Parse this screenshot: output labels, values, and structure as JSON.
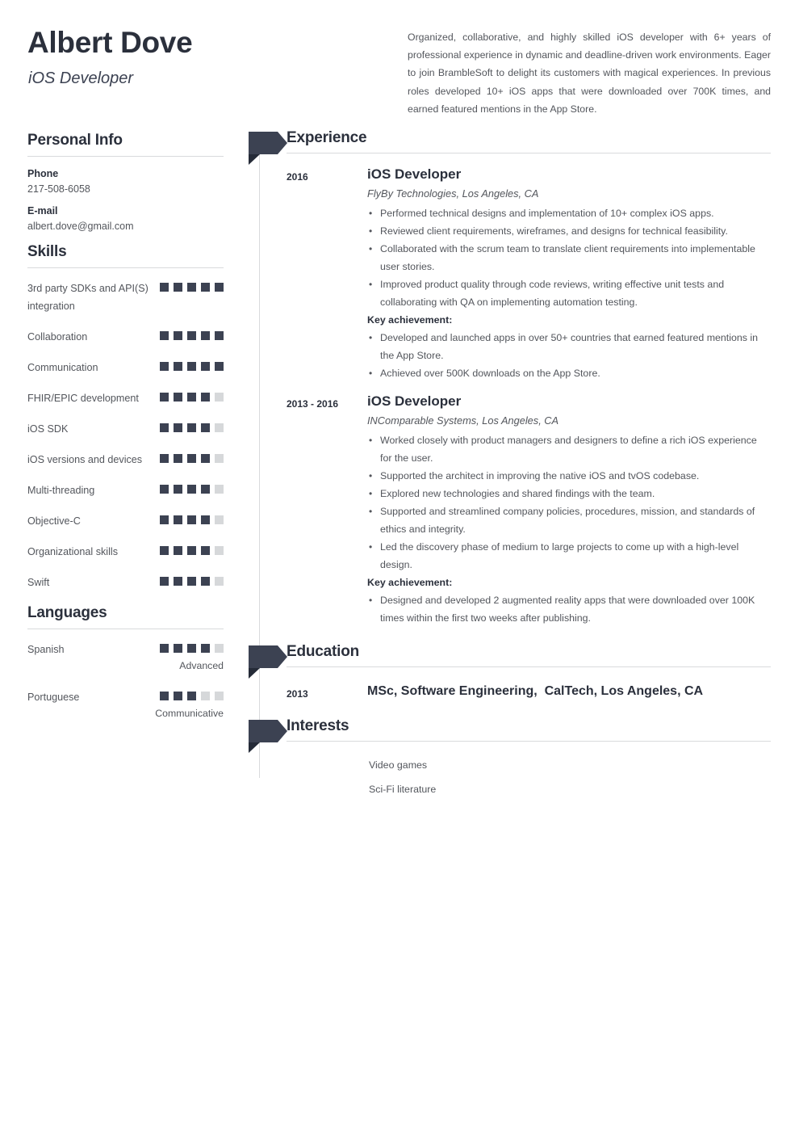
{
  "header": {
    "name": "Albert Dove",
    "job_title": "iOS Developer",
    "summary": "Organized, collaborative, and highly skilled iOS developer with 6+ years of professional experience in dynamic and deadline-driven work environments. Eager to join BrambleSoft to delight its customers with magical experiences. In previous roles developed 10+ iOS apps that were downloaded over 700K times, and earned featured mentions in the App Store."
  },
  "sidebar": {
    "personal_info": {
      "heading": "Personal Info",
      "fields": [
        {
          "label": "Phone",
          "value": "217-508-6058"
        },
        {
          "label": "E-mail",
          "value": "albert.dove@gmail.com"
        }
      ]
    },
    "skills": {
      "heading": "Skills",
      "max": 5,
      "items": [
        {
          "label": "3rd party SDKs and API(S) integration",
          "level": 5
        },
        {
          "label": "Collaboration",
          "level": 5
        },
        {
          "label": "Communication",
          "level": 5
        },
        {
          "label": "FHIR/EPIC development",
          "level": 4
        },
        {
          "label": "iOS SDK",
          "level": 4
        },
        {
          "label": "iOS versions and devices",
          "level": 4
        },
        {
          "label": "Multi-threading",
          "level": 4
        },
        {
          "label": "Objective-C",
          "level": 4
        },
        {
          "label": "Organizational skills",
          "level": 4
        },
        {
          "label": "Swift",
          "level": 4
        }
      ]
    },
    "languages": {
      "heading": "Languages",
      "max": 5,
      "items": [
        {
          "label": "Spanish",
          "level": 4,
          "note": "Advanced"
        },
        {
          "label": "Portuguese",
          "level": 3,
          "note": "Communicative"
        }
      ]
    }
  },
  "main": {
    "experience": {
      "heading": "Experience",
      "entries": [
        {
          "date": "2016",
          "role": "iOS Developer",
          "org": "FlyBy Technologies, Los Angeles, CA",
          "bullets": [
            "Performed technical designs and implementation of 10+ complex iOS apps.",
            "Reviewed client requirements, wireframes, and designs for technical feasibility.",
            "Collaborated with the scrum team to translate client requirements into implementable user stories.",
            "Improved product quality through code reviews, writing effective unit tests and collaborating with QA on implementing automation testing."
          ],
          "key_achievement_label": "Key achievement:",
          "achievements": [
            "Developed and launched apps in over 50+ countries that earned featured mentions in the App Store.",
            "Achieved over 500K downloads on the App Store."
          ]
        },
        {
          "date": "2013 - 2016",
          "role": "iOS Developer",
          "org": "INComparable Systems, Los Angeles, CA",
          "bullets": [
            "Worked closely with product managers and designers to define a rich iOS experience for the user.",
            "Supported the architect in improving the native iOS and tvOS codebase.",
            "Explored new technologies and shared findings with the team.",
            "Supported and streamlined company policies, procedures, mission, and standards of ethics and integrity.",
            "Led the discovery phase of medium to large projects to come up with a high-level design."
          ],
          "key_achievement_label": "Key achievement:",
          "achievements": [
            "Designed and developed 2 augmented reality apps that were downloaded over 100K times within the first two weeks after publishing."
          ]
        }
      ]
    },
    "education": {
      "heading": "Education",
      "entries": [
        {
          "date": "2013",
          "line": "MSc, Software Engineering,  CalTech, Los Angeles, CA"
        }
      ]
    },
    "interests": {
      "heading": "Interests",
      "items": [
        "Video games",
        "Sci-Fi literature"
      ]
    }
  },
  "colors": {
    "ink": "#2b303c",
    "accent": "#3c4252",
    "muted": "#53565c",
    "empty_square": "#d6d8da",
    "rule": "#d9dadc"
  }
}
